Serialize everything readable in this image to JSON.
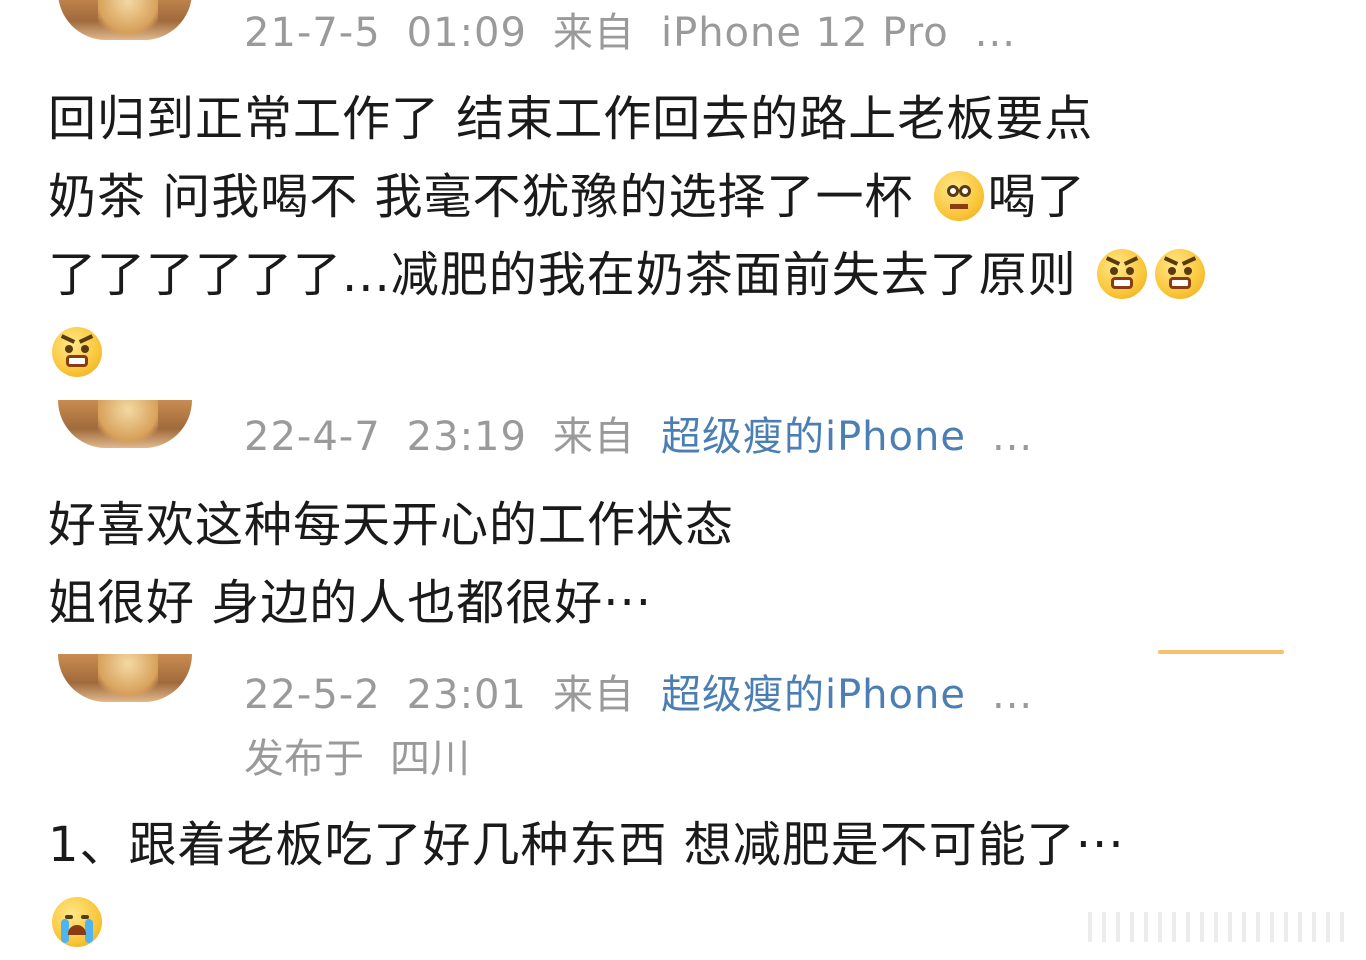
{
  "comments": [
    {
      "meta": {
        "date": "21-7-5",
        "time": "01:09",
        "from_label": "来自",
        "device": "iPhone  12  Pro",
        "more": "..."
      },
      "body": {
        "line1": "回归到正常工作了  结束工作回去的路上老板要点",
        "line2": "奶茶  问我喝不  我毫不犹豫的选择了一杯 ",
        "line2_tail": "喝了",
        "line3": "了了了了了了...减肥的我在奶茶面前失去了原则 "
      }
    },
    {
      "meta": {
        "date": "22-4-7",
        "time": "23:19",
        "from_label": "来自",
        "device": "超级瘦的iPhone",
        "more": "..."
      },
      "body": {
        "line1": "好喜欢这种每天开心的工作状态",
        "line2": "姐很好  身边的人也都很好···"
      }
    },
    {
      "meta": {
        "date": "22-5-2",
        "time": "23:01",
        "from_label": "来自",
        "device": "超级瘦的iPhone",
        "more": "..."
      },
      "location": {
        "label": "发布于",
        "place": "四川"
      },
      "body": {
        "line1": "1、跟着老板吃了好几种东西  想减肥是不可能了···"
      }
    }
  ],
  "emoji_names": [
    "pitiful-face-icon",
    "angry-face-icon",
    "crying-face-icon"
  ]
}
